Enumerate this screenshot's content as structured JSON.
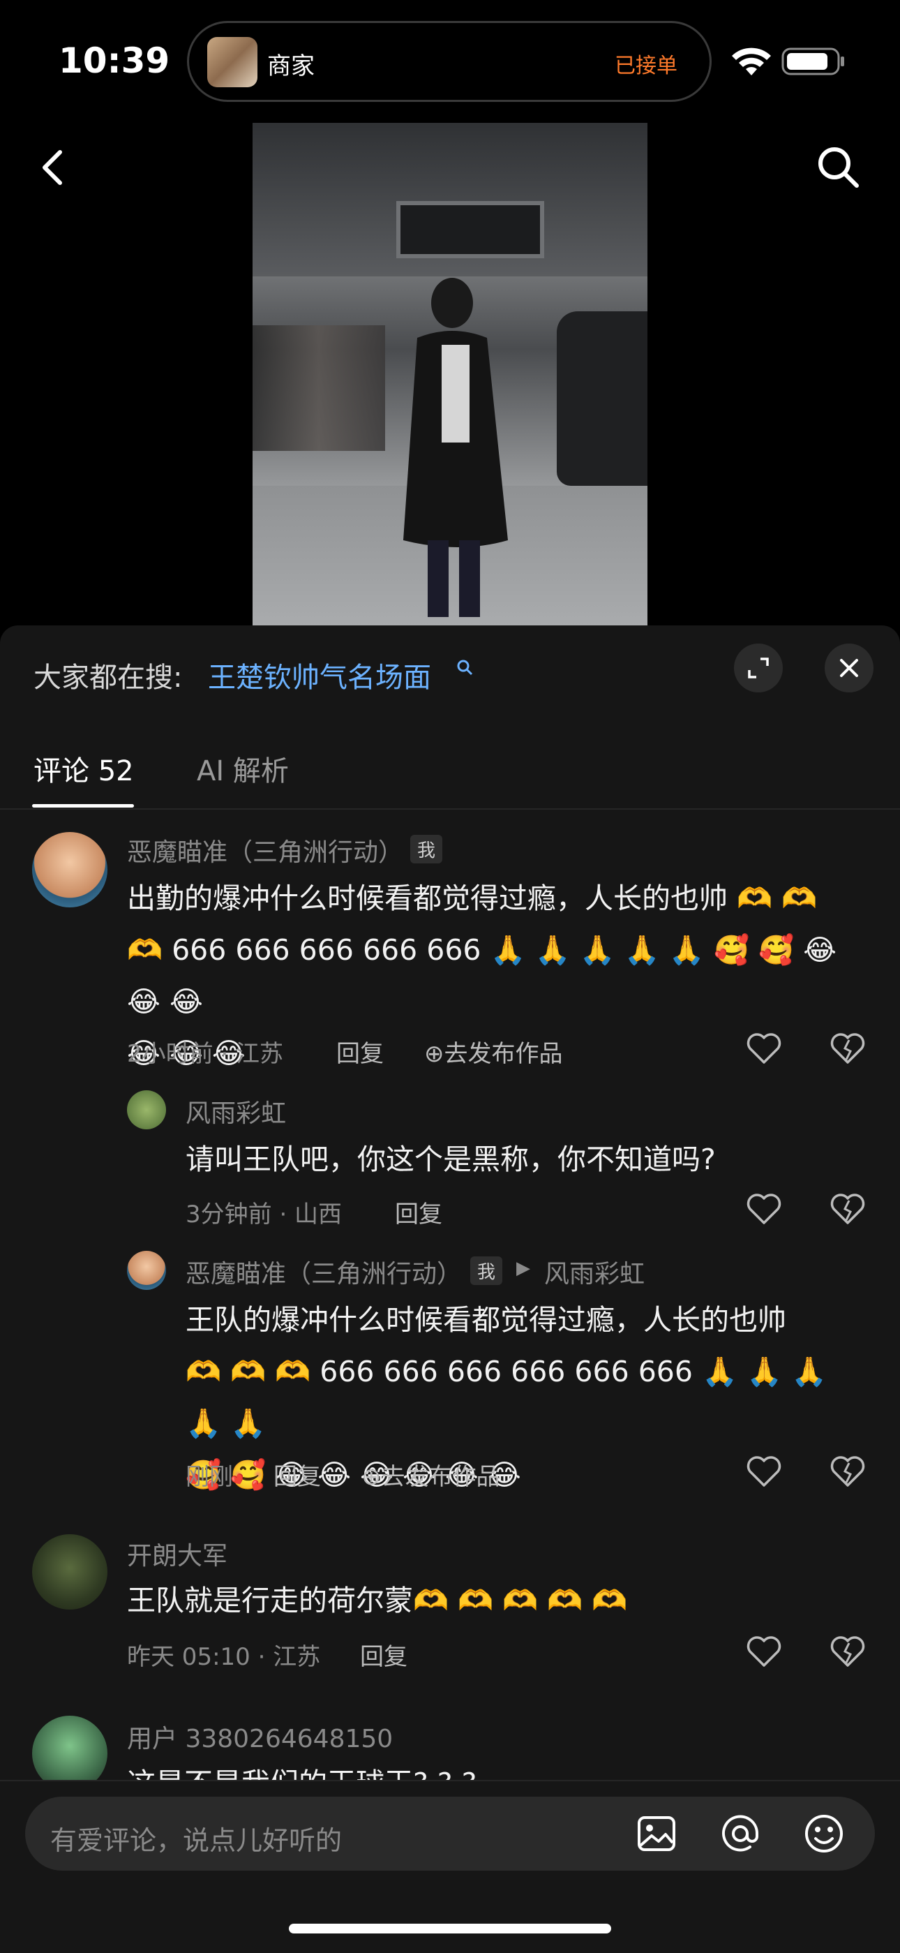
{
  "status_bar": {
    "time": "10:39",
    "live_activity_title": "商家",
    "live_activity_status": "已接单"
  },
  "search_suggestion": {
    "prefix": "大家都在搜:",
    "query": "王楚钦帅气名场面"
  },
  "tabs": [
    {
      "label": "评论 52",
      "active": true
    },
    {
      "label": "AI 解析",
      "active": false
    }
  ],
  "comments": [
    {
      "name": "恶魔瞄准（三角洲行动）",
      "badge": "我",
      "text_line1": "出勤的爆冲什么时候看都觉得过瘾，人长的也帅 🫶 🫶",
      "text_line2": "🫶 666 666 666 666 666 🙏 🙏 🙏 🙏 🙏 🥰 🥰 😂 😂 😂",
      "text_line3": "😂 😂 😂",
      "time_location": "2小时前 · 江苏",
      "reply_label": "回复",
      "publish_label": "去发布作品"
    },
    {
      "name": "风雨彩虹",
      "text": "请叫王队吧，你这个是黑称，你不知道吗?",
      "time_location": "3分钟前 · 山西",
      "reply_label": "回复"
    },
    {
      "name": "恶魔瞄准（三角洲行动）",
      "badge": "我",
      "reply_to": "风雨彩虹",
      "text_line1": "王队的爆冲什么时候看都觉得过瘾，人长的也帅",
      "text_line2": "🫶 🫶 🫶 666 666 666 666 666 666 🙏 🙏 🙏 🙏 🙏",
      "text_line3": "🥰 🥰 😂 😂 😂 😂 😂 😂",
      "time_location": "刚刚",
      "reply_label": "回复",
      "publish_label": "去发布作品"
    },
    {
      "name": "开朗大军",
      "text": "王队就是行走的荷尔蒙🫶 🫶 🫶 🫶 🫶",
      "time_location": "昨天 05:10 · 江苏",
      "reply_label": "回复"
    },
    {
      "name": "用户 3380264648150",
      "text": "这是不是我们的王球王? ? ?"
    }
  ],
  "input": {
    "placeholder": "有爱评论，说点儿好听的"
  },
  "colors": {
    "accent_link": "#6cb2ff",
    "live_status": "#ff7a2b",
    "sheet_background": "#161616"
  }
}
